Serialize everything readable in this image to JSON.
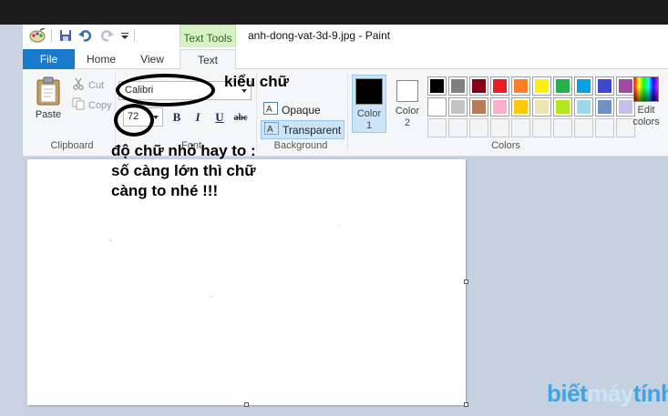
{
  "window": {
    "title": "anh-dong-vat-3d-9.jpg - Paint",
    "context_tab": "Text Tools"
  },
  "tabs": {
    "file": "File",
    "home": "Home",
    "view": "View",
    "text": "Text"
  },
  "clipboard": {
    "paste": "Paste",
    "cut": "Cut",
    "copy": "Copy",
    "group_label": "Clipboard"
  },
  "font": {
    "family": "Calibri",
    "size": "72",
    "group_label": "Font",
    "bold": "B",
    "italic": "I",
    "underline": "U",
    "strike": "abc"
  },
  "background": {
    "opaque": "Opaque",
    "transparent": "Transparent",
    "group_label": "Background"
  },
  "colors": {
    "color1_label": "Color 1",
    "color2_label": "Color 2",
    "color1": "#000000",
    "color2": "#ffffff",
    "edit_label": "Edit colors",
    "group_label": "Colors",
    "palette_row1": [
      "#000000",
      "#7f7f7f",
      "#880015",
      "#ed1c24",
      "#ff7f27",
      "#fff200",
      "#22b14c",
      "#00a2e8",
      "#3f48cc",
      "#a349a4"
    ],
    "palette_row2": [
      "#ffffff",
      "#c3c3c3",
      "#b97a57",
      "#ffaec9",
      "#ffc90e",
      "#efe4b0",
      "#b5e61d",
      "#99d9ea",
      "#7092be",
      "#c8bfe7"
    ]
  },
  "annotations": {
    "font_name_note": "kiểu chữ",
    "font_size_note_1": "độ chữ nhỏ hay to :",
    "font_size_note_2": "số càng lớn thì chữ",
    "font_size_note_3": "càng to nhé !!!"
  },
  "watermark": {
    "part1": "biết",
    "part2": "máy",
    "part3": "tính"
  }
}
